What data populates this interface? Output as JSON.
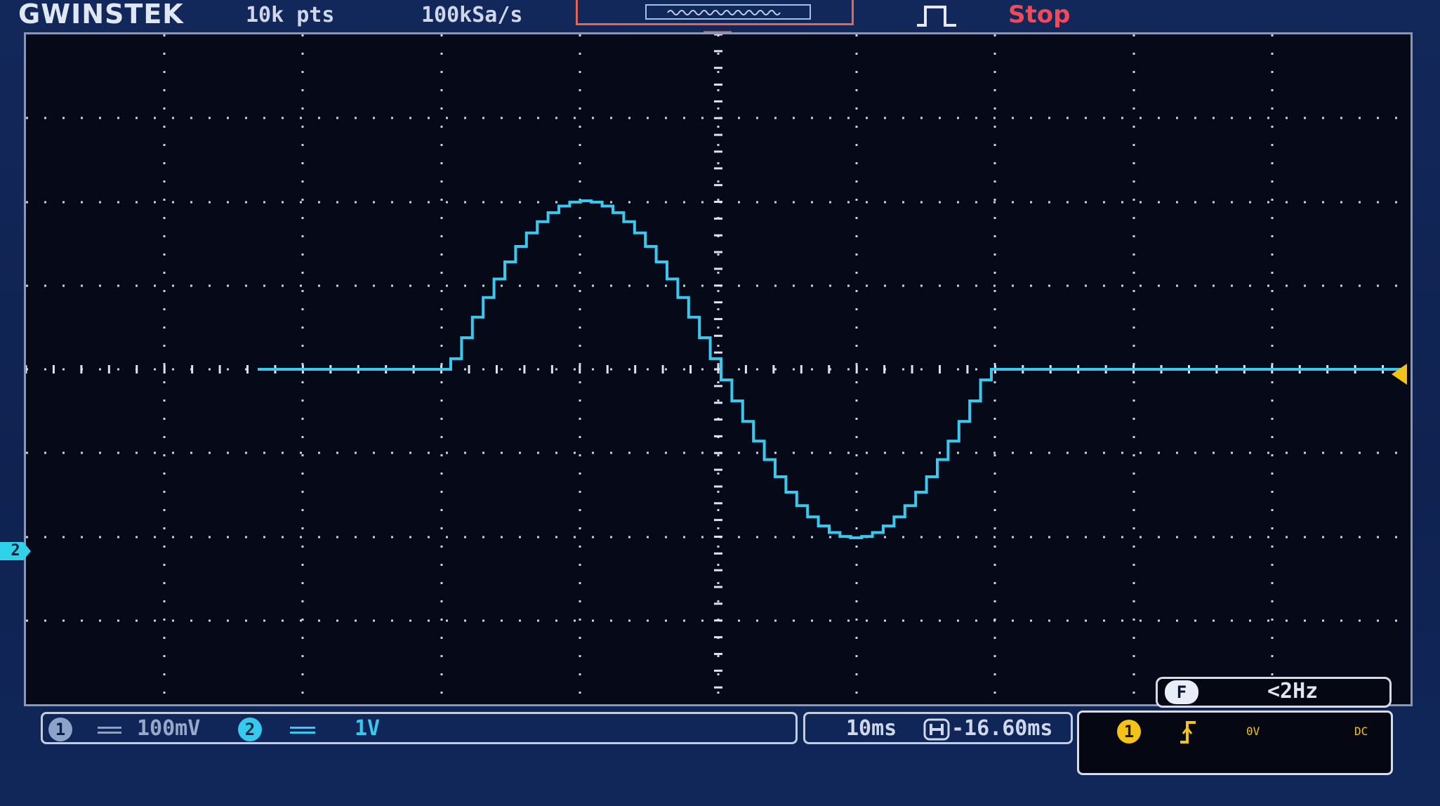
{
  "top_bar": {
    "brand": "GWINSTEK",
    "memory_length": "10k pts",
    "sample_rate": "100kSa/s",
    "acquire_status": "Stop"
  },
  "channels": {
    "ch1": {
      "number": "1",
      "coupling_icon": "dc-coupling-icon",
      "scale": "100mV",
      "color": "#8da3c8"
    },
    "ch2": {
      "number": "2",
      "coupling_icon": "dc-coupling-icon",
      "scale": "1V",
      "color": "#38c9ee"
    }
  },
  "timebase": {
    "scale": "10ms",
    "position_icon": "horizontal-position-icon",
    "position": "-16.60ms"
  },
  "trigger": {
    "source": "1",
    "slope_icon": "rising-edge-icon",
    "level": "0V",
    "coupling": "DC",
    "color": "#f3c318"
  },
  "frequency": {
    "badge": "F",
    "value": "<2Hz"
  },
  "colors": {
    "background": "#13285a",
    "grid": "#c9d2e6",
    "trace": "#38c9ee",
    "stop": "#f04a58",
    "marker": "#f26d57"
  }
}
